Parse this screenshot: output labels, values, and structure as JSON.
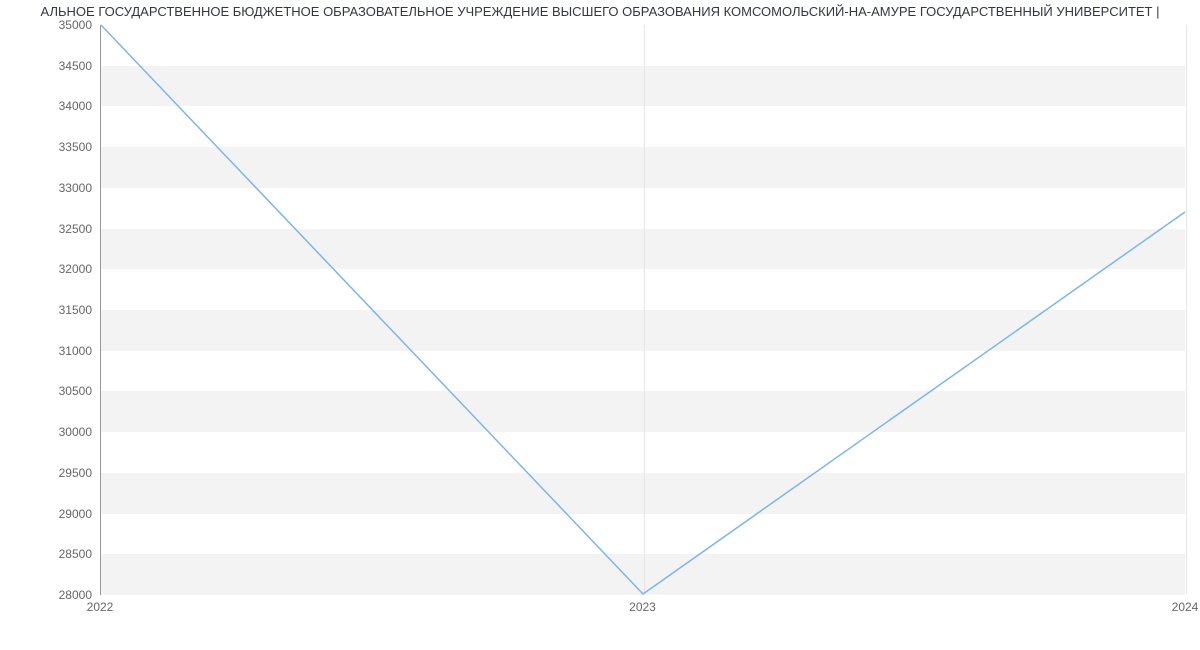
{
  "title": "АЛЬНОЕ ГОСУДАРСТВЕННОЕ БЮДЖЕТНОЕ ОБРАЗОВАТЕЛЬНОЕ УЧРЕЖДЕНИЕ ВЫСШЕГО ОБРАЗОВАНИЯ КОМСОМОЛЬСКИЙ-НА-АМУРЕ ГОСУДАРСТВЕННЫЙ УНИВЕРСИТЕТ |",
  "chart_data": {
    "type": "line",
    "x": [
      2022,
      2023,
      2024
    ],
    "values": [
      35000,
      28000,
      32700
    ],
    "xlim": [
      2022,
      2024
    ],
    "ylim": [
      28000,
      35000
    ],
    "y_ticks": [
      28000,
      28500,
      29000,
      29500,
      30000,
      30500,
      31000,
      31500,
      32000,
      32500,
      33000,
      33500,
      34000,
      34500,
      35000
    ],
    "x_ticks": [
      2022,
      2023,
      2024
    ],
    "line_color": "#7cb5ec",
    "band_color": "#f3f3f3"
  }
}
